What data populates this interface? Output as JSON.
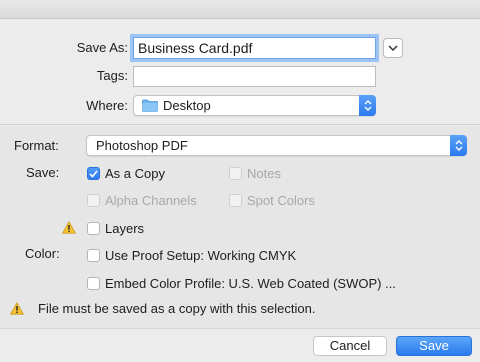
{
  "save_as": {
    "label": "Save As:",
    "value": "Business Card.pdf"
  },
  "tags": {
    "label": "Tags:",
    "value": ""
  },
  "where": {
    "label": "Where:",
    "value": "Desktop",
    "icon": "folder-icon"
  },
  "format": {
    "label": "Format:",
    "value": "Photoshop PDF"
  },
  "save_options": {
    "label": "Save:",
    "as_a_copy": {
      "label": "As a Copy",
      "checked": true,
      "enabled": true
    },
    "notes": {
      "label": "Notes",
      "checked": false,
      "enabled": false
    },
    "alpha_channels": {
      "label": "Alpha Channels",
      "checked": false,
      "enabled": false
    },
    "spot_colors": {
      "label": "Spot Colors",
      "checked": false,
      "enabled": false
    },
    "layers": {
      "label": "Layers",
      "checked": false,
      "enabled": true
    }
  },
  "color_options": {
    "label": "Color:",
    "use_proof_setup": {
      "label": "Use Proof Setup:  Working CMYK",
      "checked": false
    },
    "embed_color_profile": {
      "label": "Embed Color Profile:  U.S. Web Coated (SWOP) ...",
      "checked": false
    }
  },
  "warning": {
    "text": "File must be saved as a copy with this selection."
  },
  "buttons": {
    "cancel": "Cancel",
    "save": "Save"
  },
  "colors": {
    "accent": "#2c7cf0",
    "warning": "#f5c232",
    "focus_ring": "#9cc3f1"
  }
}
